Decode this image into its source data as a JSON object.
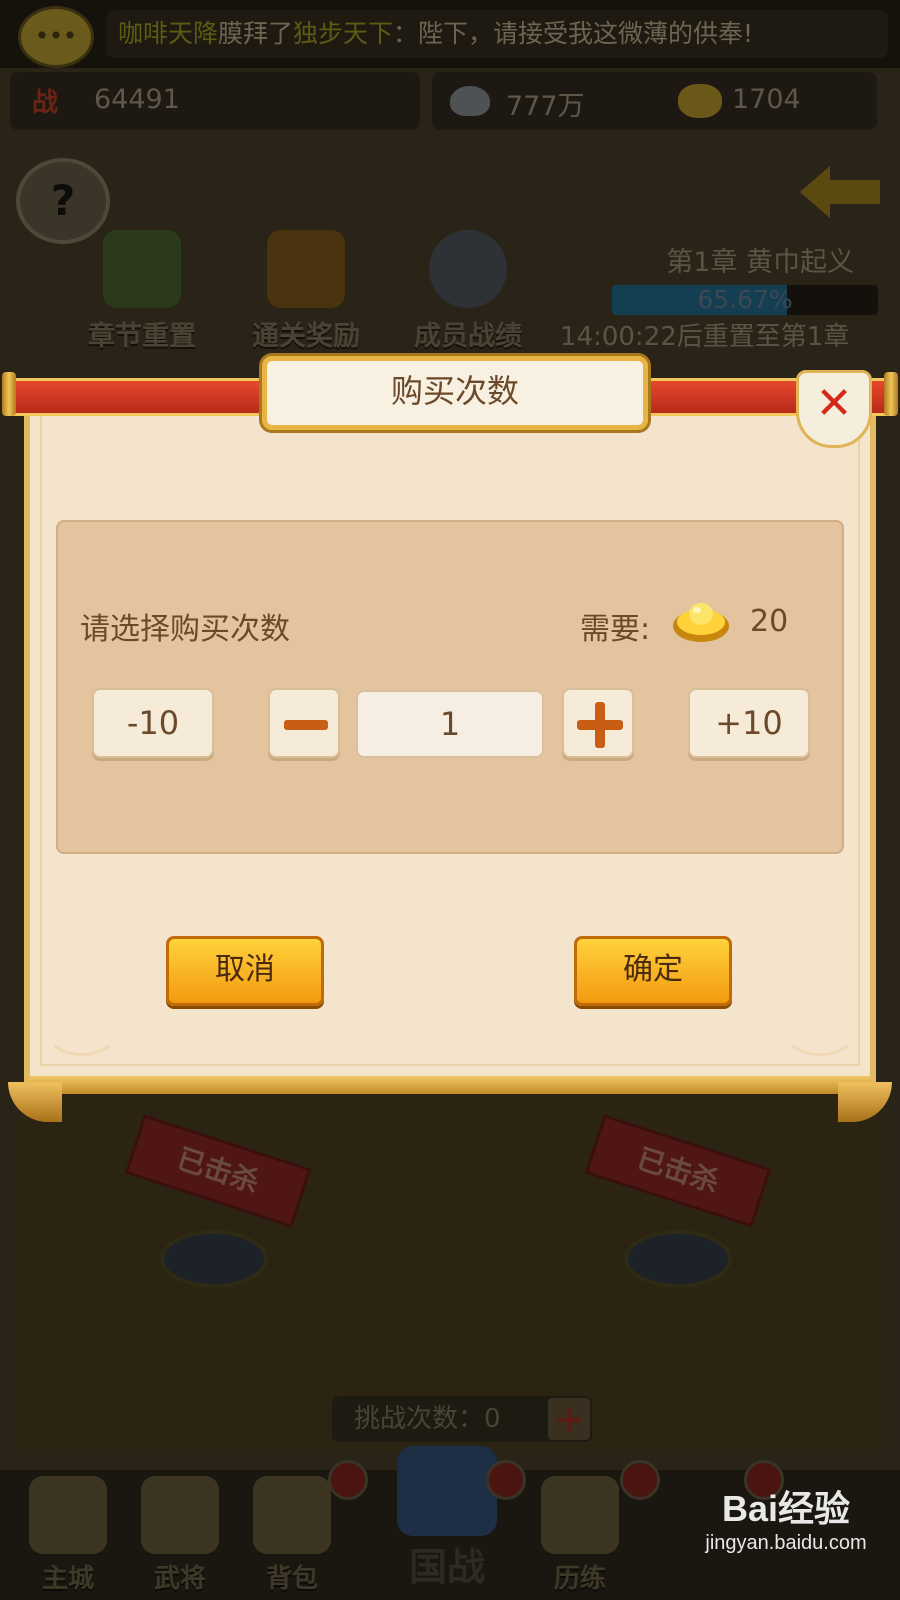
{
  "background": {
    "chat": {
      "sender": "咖啡天降",
      "verb": "膜拜了",
      "target": "独步天下",
      "message": "：陛下，请接受我这微薄的供奉!"
    },
    "stats": {
      "power_label": "战",
      "power": "64491",
      "silver": "777万",
      "gold": "1704"
    },
    "help": "?",
    "menu": [
      {
        "label": "章节重置",
        "icon": "chapter-reset-icon"
      },
      {
        "label": "通关奖励",
        "icon": "treasure-chest-icon"
      },
      {
        "label": "成员战绩",
        "icon": "sword-shield-icon"
      }
    ],
    "chapter": {
      "title": "第1章  黄巾起义",
      "progress_text": "65.67%",
      "progress": 0.6567,
      "reset_text": "14:00:22后重置至第1章"
    },
    "killed_tag": "已击杀",
    "challenge": {
      "label": "挑战次数：",
      "count": "0"
    },
    "nav": [
      {
        "label": "主城",
        "icon": "castle-icon"
      },
      {
        "label": "武将",
        "icon": "generals-icon"
      },
      {
        "label": "背包",
        "icon": "backpack-icon"
      },
      {
        "label": "国战",
        "icon": "national-war-icon"
      },
      {
        "label": "历练",
        "icon": "training-icon"
      }
    ]
  },
  "dialog": {
    "title": "购买次数",
    "close_icon": "close-icon",
    "prompt": "请选择购买次数",
    "cost_label": "需要:",
    "cost": "20",
    "cost_icon": "gold-ingot-icon",
    "minus10": "-10",
    "plus10": "+10",
    "quantity": "1",
    "cancel": "取消",
    "confirm": "确定"
  },
  "watermark": {
    "logo": "Bai经验",
    "url": "jingyan.baidu.com"
  },
  "colors": {
    "banner_red": "#d83a22",
    "gold_trim": "#e8b446",
    "parchment": "#f4e4cc",
    "panel": "#e3c49f",
    "button_orange": "#f7b022",
    "close_red": "#d42818",
    "text_brown": "#6a4a2a"
  }
}
